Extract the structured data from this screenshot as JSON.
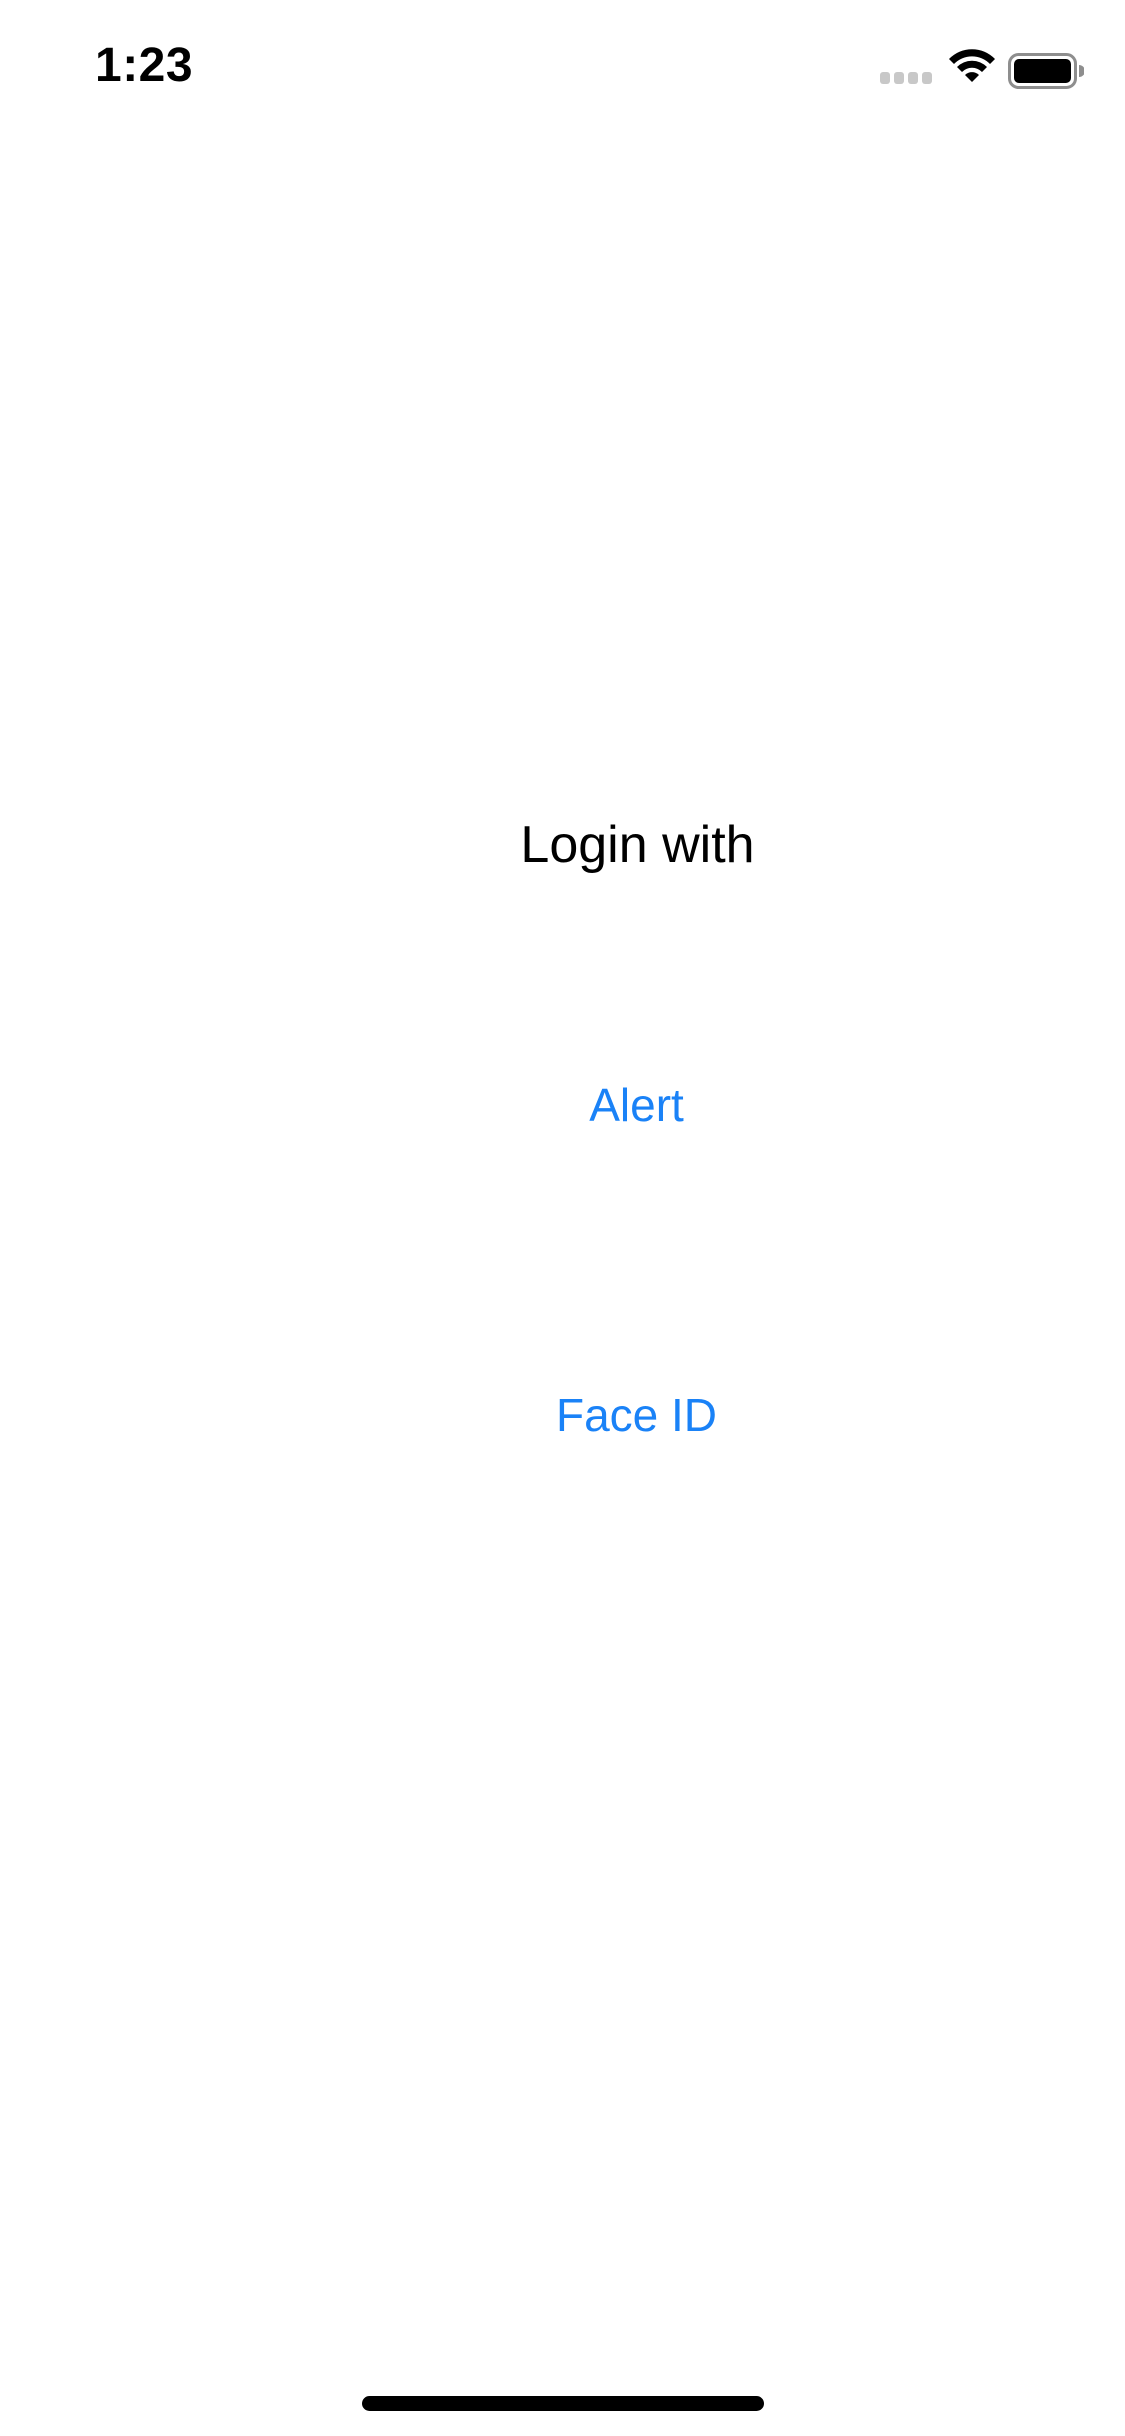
{
  "status_bar": {
    "time": "1:23",
    "icons": [
      "cellular-signal-icon",
      "wifi-icon",
      "battery-icon"
    ]
  },
  "main": {
    "login_label": "Login with",
    "buttons": [
      {
        "label": "Alert"
      },
      {
        "label": "Face ID"
      }
    ]
  },
  "colors": {
    "accent": "#1a82f7",
    "text": "#000000",
    "background": "#ffffff"
  }
}
